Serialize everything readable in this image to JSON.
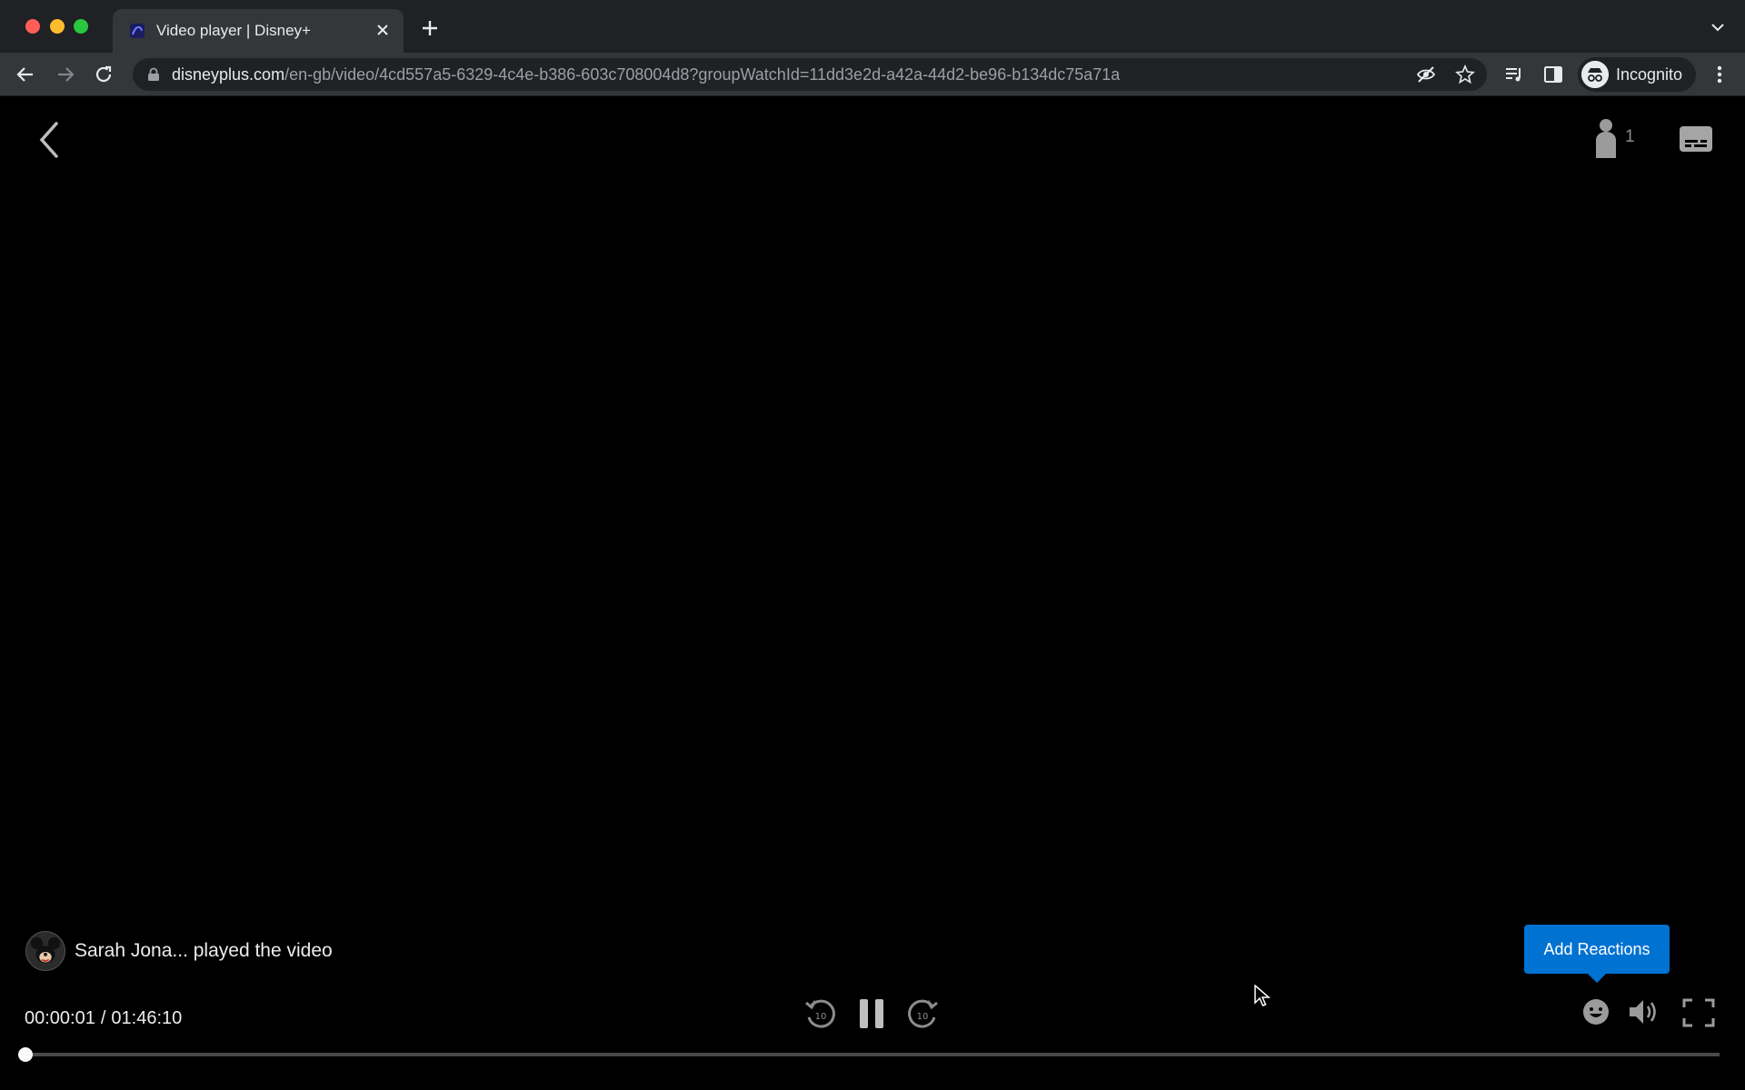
{
  "browser": {
    "tab_title": "Video player | Disney+",
    "url_host": "disneyplus.com",
    "url_path": "/en-gb/video/4cd557a5-6329-4c4e-b386-603c708004d8?groupWatchId=11dd3e2d-a42a-44d2-be96-b134dc75a71a",
    "profile_label": "Incognito"
  },
  "player": {
    "viewer_count": "1",
    "notification": "Sarah Jona... played the video",
    "reactions_tooltip": "Add Reactions",
    "current_time": "00:00:01",
    "time_separator": "/",
    "duration": "01:46:10",
    "rewind_label": "10",
    "forward_label": "10",
    "progress_fraction": 0.0002
  },
  "colors": {
    "accent": "#0072d2",
    "tab_bar": "#202124",
    "toolbar": "#35363a"
  }
}
